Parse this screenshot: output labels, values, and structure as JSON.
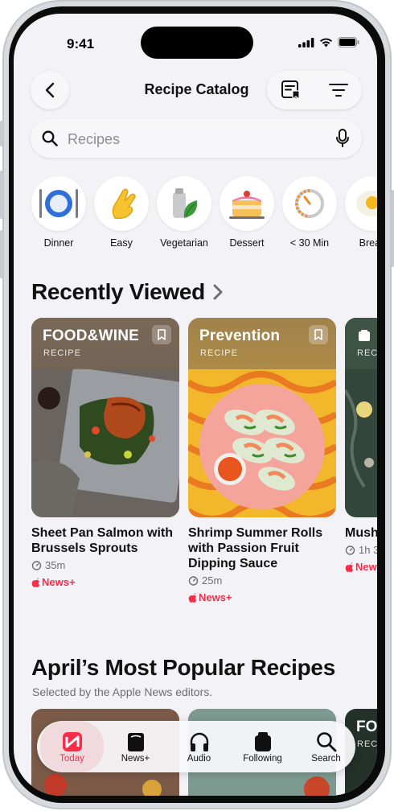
{
  "status": {
    "time": "9:41"
  },
  "header": {
    "title": "Recipe Catalog"
  },
  "search": {
    "placeholder": "Recipes"
  },
  "categories": [
    {
      "label": "Dinner"
    },
    {
      "label": "Easy"
    },
    {
      "label": "Vegetarian"
    },
    {
      "label": "Dessert"
    },
    {
      "label": "< 30 Min"
    },
    {
      "label": "Break"
    }
  ],
  "recently_viewed": {
    "title": "Recently Viewed",
    "cards": [
      {
        "brand": "FOOD&WINE",
        "kind": "RECIPE",
        "title": "Sheet Pan Salmon with Brussels Sprouts",
        "time": "35m",
        "badge": "News+",
        "band_color": "#7a6857"
      },
      {
        "brand": "Prevention",
        "kind": "RECIPE",
        "title": "Shrimp Summer Rolls with Passion Fruit Dipping Sauce",
        "time": "25m",
        "badge": "News+",
        "band_color": "#a0834c"
      },
      {
        "brand": "",
        "kind": "REC",
        "title": "Mush",
        "time": "1h 3",
        "badge": "News",
        "band_color": "#3d5446"
      }
    ]
  },
  "popular": {
    "title": "April’s Most Popular Recipes",
    "subtitle": "Selected by the Apple News editors."
  },
  "tabs": [
    {
      "label": "Today",
      "active": true
    },
    {
      "label": "News+",
      "active": false
    },
    {
      "label": "Audio",
      "active": false
    },
    {
      "label": "Following",
      "active": false
    },
    {
      "label": "Search",
      "active": false
    }
  ],
  "colors": {
    "accent": "#fa2d48",
    "background": "#f2f2f7"
  }
}
